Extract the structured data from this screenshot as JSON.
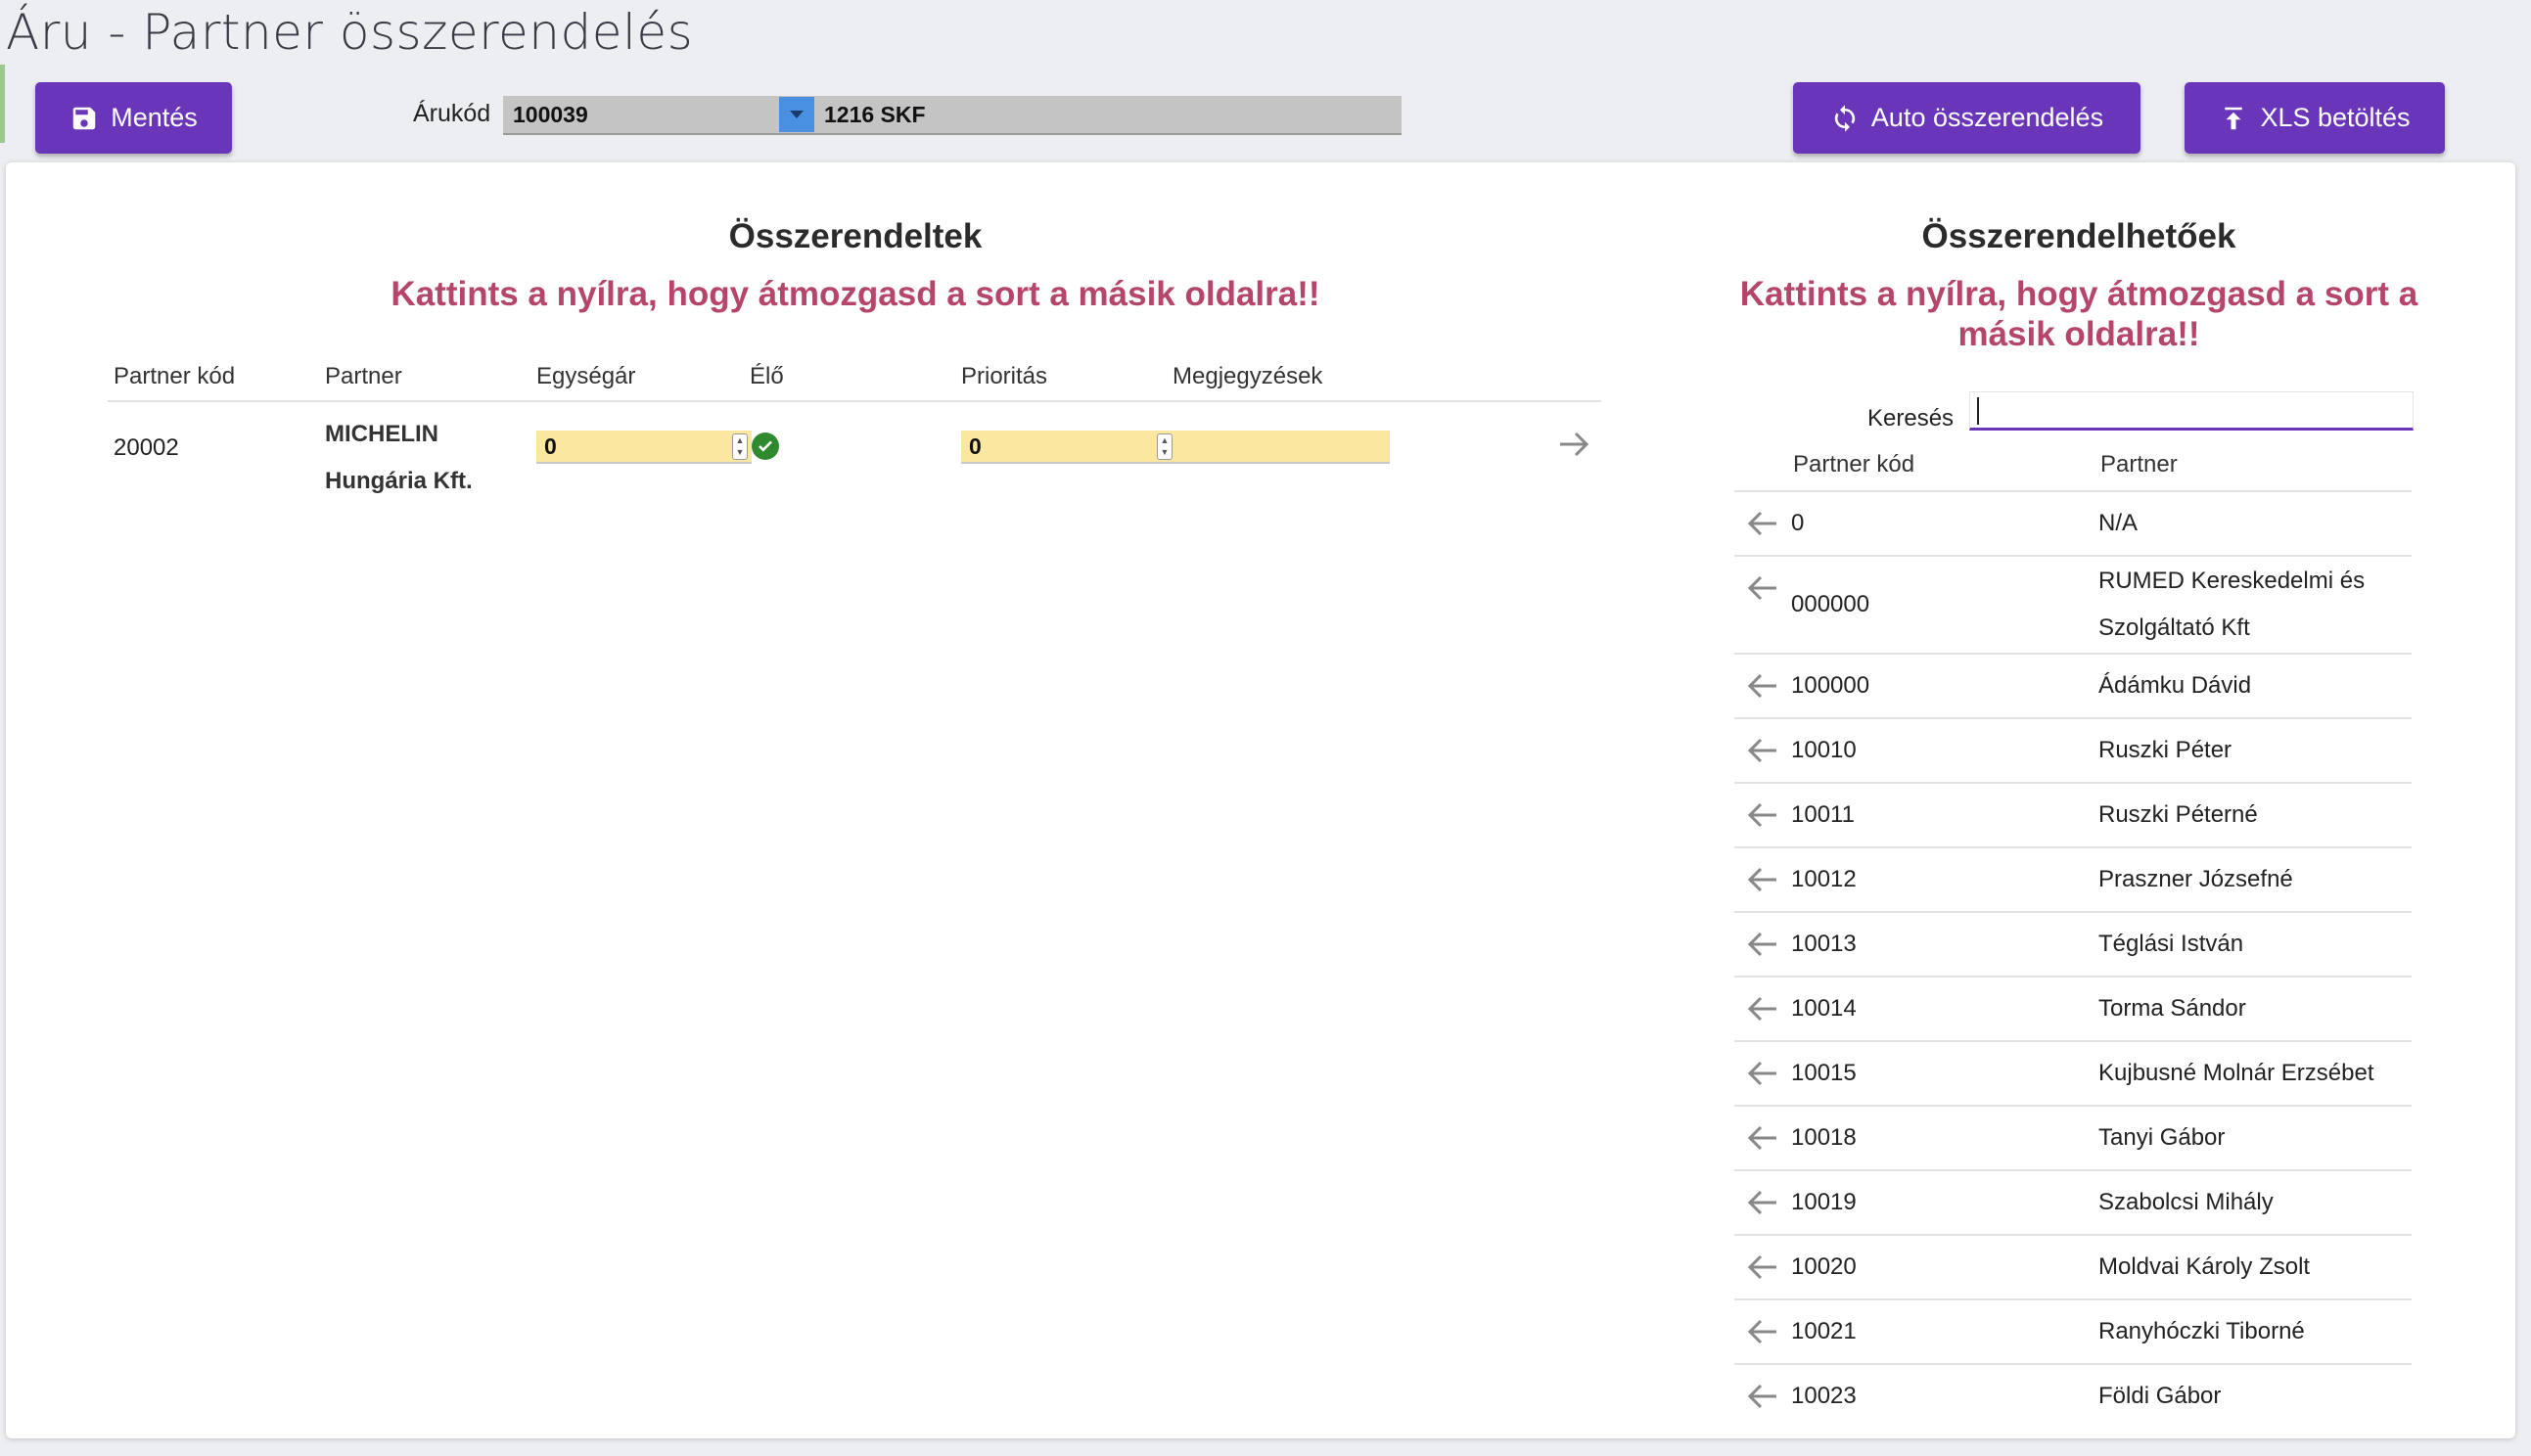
{
  "page": {
    "title": "Áru - Partner összerendelés"
  },
  "toolbar": {
    "save_label": "Mentés",
    "auto_label": "Auto összerendelés",
    "xls_label": "XLS betöltés",
    "arukod_label": "Árukód",
    "arukod_code": "100039",
    "arukod_name": "1216 SKF"
  },
  "left": {
    "title": "Összerendeltek",
    "hint": "Kattints a nyílra, hogy átmozgasd a sort a másik oldalra!!",
    "columns": [
      "Partner kód",
      "Partner",
      "Egységár",
      "Élő",
      "Prioritás",
      "Megjegyzések"
    ],
    "row": {
      "code": "20002",
      "partner_line1": "MICHELIN",
      "partner_line2": "Hungária Kft.",
      "price": "0",
      "priority": "0"
    }
  },
  "right": {
    "title": "Összerendelhetőek",
    "hint": "Kattints a nyílra, hogy átmozgasd a sort a másik oldalra!!",
    "search_label": "Keresés",
    "search_value": "",
    "columns": [
      "Partner kód",
      "Partner"
    ],
    "rows": [
      {
        "code": "0",
        "name": "N/A"
      },
      {
        "code": "000000",
        "name": "RUMED Kereskedelmi és Szolgáltató Kft"
      },
      {
        "code": "100000",
        "name": "Ádámku Dávid"
      },
      {
        "code": "10010",
        "name": "Ruszki Péter"
      },
      {
        "code": "10011",
        "name": "Ruszki Péterné"
      },
      {
        "code": "10012",
        "name": "Praszner Józsefné"
      },
      {
        "code": "10013",
        "name": "Téglási István"
      },
      {
        "code": "10014",
        "name": "Torma Sándor"
      },
      {
        "code": "10015",
        "name": "Kujbusné Molnár Erzsébet"
      },
      {
        "code": "10018",
        "name": "Tanyi Gábor"
      },
      {
        "code": "10019",
        "name": "Szabolcsi Mihály"
      },
      {
        "code": "10020",
        "name": "Moldvai Károly Zsolt"
      },
      {
        "code": "10021",
        "name": "Ranyhóczki Tiborné"
      },
      {
        "code": "10023",
        "name": "Földi Gábor"
      }
    ]
  },
  "colors": {
    "accent": "#6936b9",
    "hint": "#b5456b",
    "input_bg": "#fce7a1",
    "live_ok": "#2f8a2f"
  }
}
